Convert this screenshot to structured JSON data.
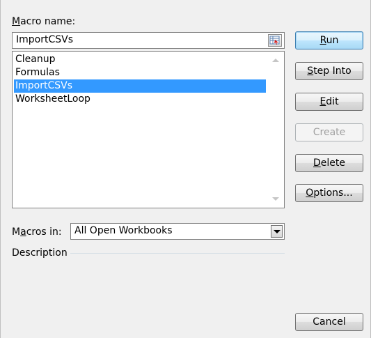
{
  "dialog": {
    "macro_name_label": "Macro name:",
    "macro_name_value": "ImportCSVs",
    "macros": [
      "Cleanup",
      "Formulas",
      "ImportCSVs",
      "WorksheetLoop"
    ],
    "selected_index": 2,
    "buttons": {
      "run": "Run",
      "step_into": "Step Into",
      "edit": "Edit",
      "create": "Create",
      "delete": "Delete",
      "options": "Options...",
      "cancel": "Cancel"
    },
    "macros_in_label": "Macros in:",
    "macros_in_value": "All Open Workbooks",
    "description_label": "Description",
    "colors": {
      "selection": "#3399ff",
      "default_button": "#3c7fb1"
    }
  }
}
